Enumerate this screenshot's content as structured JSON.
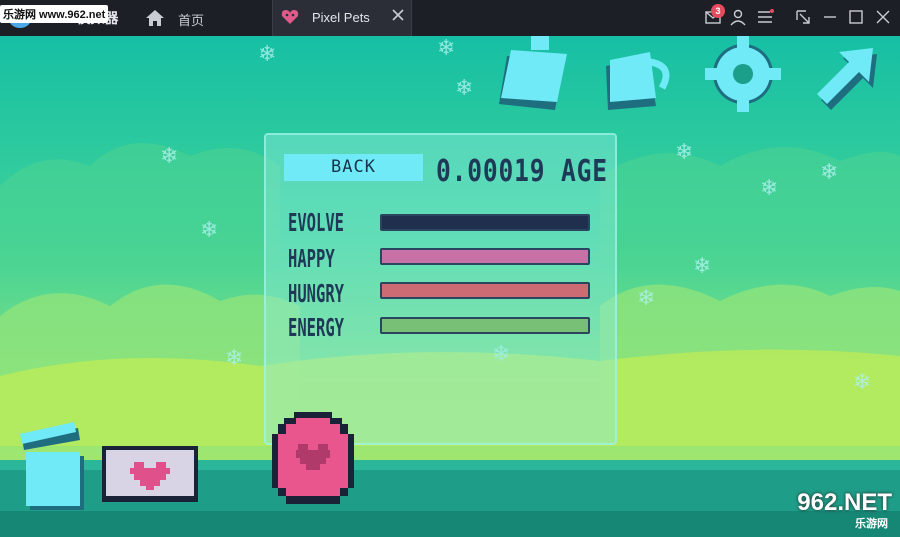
{
  "titlebar": {
    "app_name": "MuMu模拟器",
    "watermark": "乐游网 www.962.net",
    "home_label": "首页",
    "tab_label": "Pixel Pets",
    "mail_badge": "3",
    "icons": [
      "home-icon",
      "pet-heart-icon",
      "close-icon",
      "mail-icon",
      "user-icon",
      "menu-icon",
      "pin-icon",
      "minimize-icon",
      "maximize-icon",
      "window-close-icon"
    ]
  },
  "game": {
    "back_label": "BACK",
    "age_text": "0.00019 AGE",
    "stats": [
      {
        "label": "EVOLVE",
        "level": 0.02,
        "color": "#1f2f4d",
        "track": "#1f2f4d"
      },
      {
        "label": "HAPPY",
        "level": 1.0,
        "color": "#c771a6",
        "track": "#c771a6"
      },
      {
        "label": "HUNGRY",
        "level": 1.0,
        "color": "#cd6b74",
        "track": "#cd6b74"
      },
      {
        "label": "ENERGY",
        "level": 1.0,
        "color": "#77c076",
        "track": "#77c076"
      }
    ],
    "top_icons": [
      "bottle-icon",
      "mug-icon",
      "gear-icon",
      "arrow-icon"
    ],
    "bottom_icons": [
      "trash-icon",
      "heart-tray-icon",
      "pet-egg-icon"
    ],
    "colors": {
      "accent": "#6feaf6",
      "text_dark": "#1e3a56"
    }
  },
  "watermark_br": {
    "main": "962.NET",
    "sub": "乐游网"
  }
}
